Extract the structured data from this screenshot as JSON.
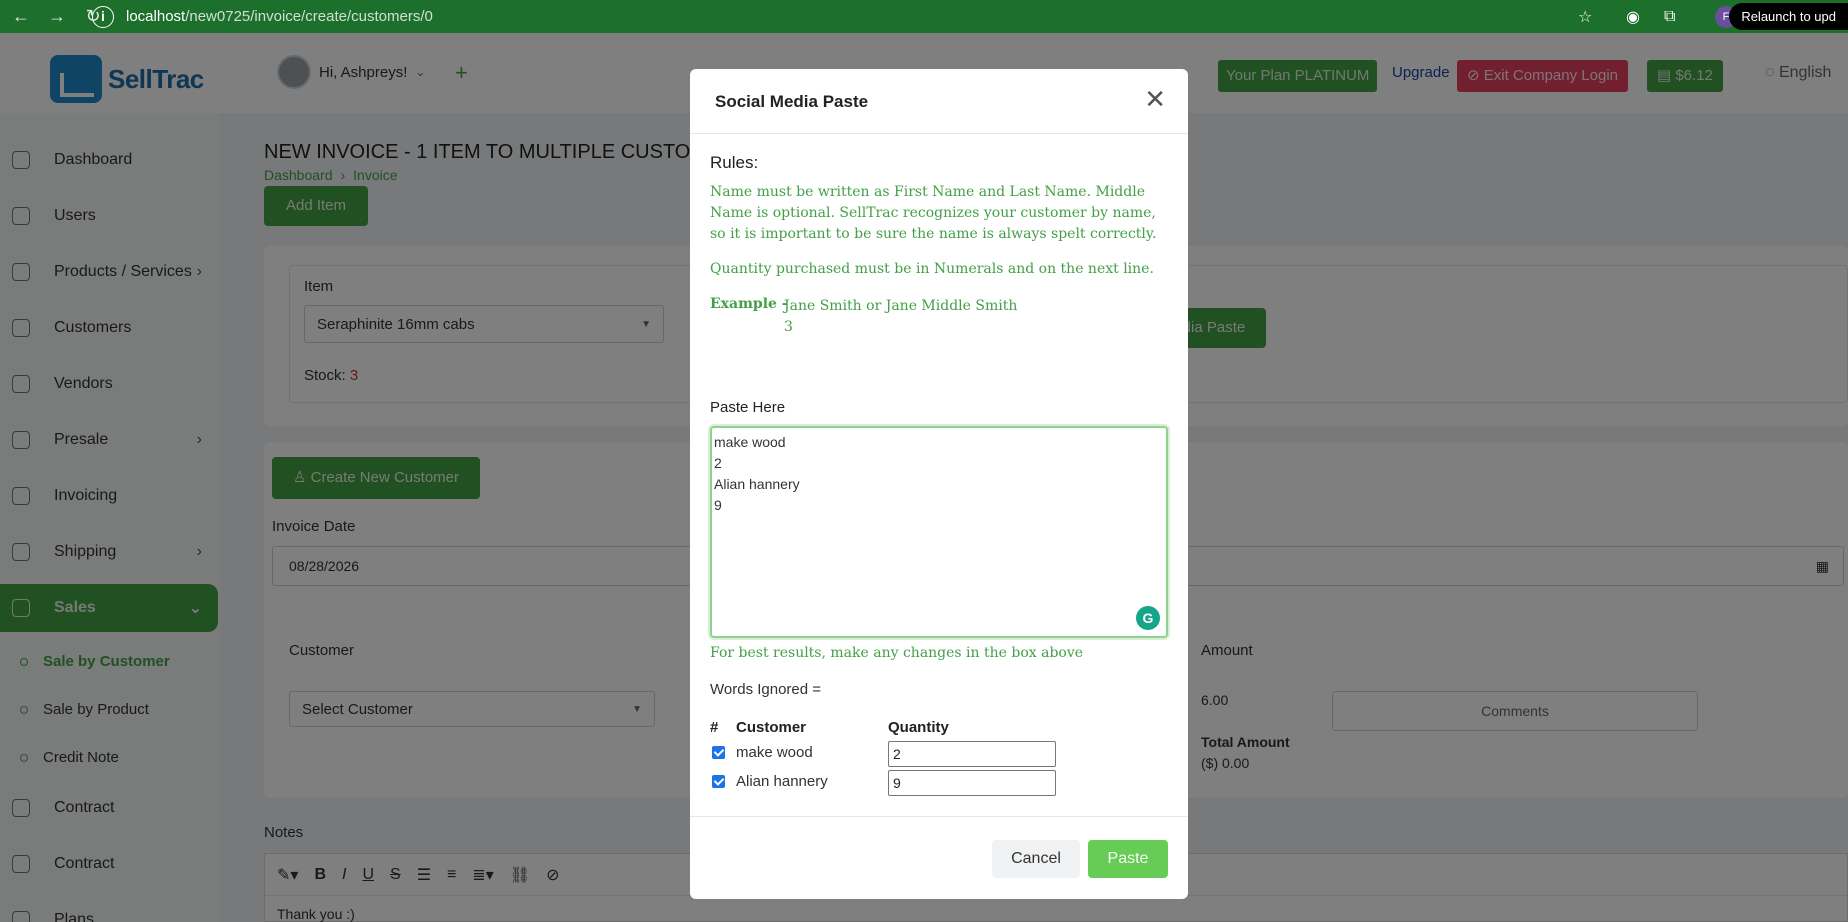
{
  "browser": {
    "url_host": "localhost",
    "url_path": "/new0725/invoice/create/customers/0",
    "relaunch_label": "Relaunch to upd",
    "profile_initial": "F"
  },
  "header": {
    "logo_text": "SellTrac",
    "user_greeting": "Hi, Ashpreys!",
    "plan_label": "Your Plan PLATINUM",
    "upgrade_label": "Upgrade",
    "exit_label": "Exit Company Login",
    "wallet_label": "$6.12",
    "language_label": "English"
  },
  "sidebar": {
    "items": [
      {
        "label": "Dashboard",
        "arrow": ""
      },
      {
        "label": "Users",
        "arrow": ""
      },
      {
        "label": "Products / Services",
        "arrow": "›"
      },
      {
        "label": "Customers",
        "arrow": ""
      },
      {
        "label": "Vendors",
        "arrow": ""
      },
      {
        "label": "Presale",
        "arrow": "›"
      },
      {
        "label": "Invoicing",
        "arrow": ""
      },
      {
        "label": "Shipping",
        "arrow": "›"
      },
      {
        "label": "Sales",
        "arrow": "⌄"
      }
    ],
    "sub_items": [
      "Sale by Customer",
      "Sale by Product",
      "Credit Note"
    ],
    "lower_items": [
      "Contract",
      "Contract",
      "Plans"
    ]
  },
  "main": {
    "title": "NEW INVOICE - 1 ITEM TO MULTIPLE CUSTOMERS",
    "breadcrumb_home": "Dashboard",
    "breadcrumb_current": "Invoice",
    "add_item_label": "Add Item",
    "item_label": "Item",
    "item_value": "Seraphinite 16mm cabs",
    "stock_label": "Stock:",
    "stock_value": "3",
    "social_paste_label": "Social Media Paste",
    "create_customer_label": "Create New Customer",
    "invoice_date_label": "Invoice Date",
    "invoice_date_value": "08/28/2026",
    "customer_label": "Customer",
    "customer_placeholder": "Select Customer",
    "amount_label": "Amount",
    "amount_value": "6.00",
    "comments_placeholder": "Comments",
    "total_label": "Total Amount",
    "total_value": "($) 0.00",
    "notes_label": "Notes",
    "notes_text": "Thank you :)"
  },
  "modal": {
    "title": "Social Media Paste",
    "rules_title": "Rules:",
    "rule_1": "Name must be written as First Name and Last Name. Middle Name is optional. SellTrac recognizes your customer by name, so it is important to be sure the name is always spelt correctly.",
    "rule_2": "Quantity purchased must be in Numerals and on the next line.",
    "example_label": "Example  -",
    "example_line_1": "Jane Smith or Jane Middle Smith",
    "example_line_2": "3",
    "paste_label": "Paste Here",
    "paste_content": "make wood\n2\nAlian hannery\n9\n",
    "hint": "For best results, make any changes in the box above",
    "words_ignored": "Words Ignored =",
    "col_hash": "#",
    "col_customer": "Customer",
    "col_quantity": "Quantity",
    "rows": [
      {
        "customer": "make wood",
        "quantity": "2",
        "checked": true
      },
      {
        "customer": "Alian hannery",
        "quantity": "9",
        "checked": true
      }
    ],
    "cancel_label": "Cancel",
    "paste_button_label": "Paste"
  },
  "colors": {
    "brand_green": "#43a047",
    "danger": "#e53e5e",
    "link_blue": "#1a3ea8"
  }
}
